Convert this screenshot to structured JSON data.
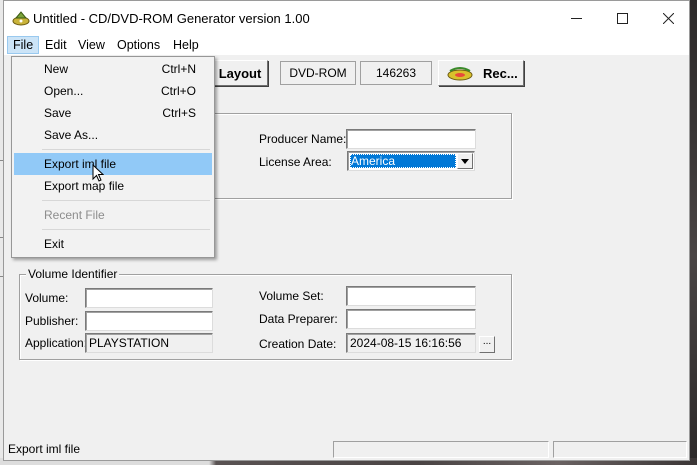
{
  "window": {
    "title": "Untitled - CD/DVD-ROM Generator version 1.00",
    "controls": {
      "minimize": "minimize-icon",
      "maximize": "maximize-icon",
      "close": "close-icon"
    }
  },
  "menubar": {
    "items": [
      "File",
      "Edit",
      "View",
      "Options",
      "Help"
    ],
    "active": "File"
  },
  "file_menu": {
    "items": [
      {
        "label": "New",
        "shortcut": "Ctrl+N"
      },
      {
        "label": "Open...",
        "shortcut": "Ctrl+O"
      },
      {
        "label": "Save",
        "shortcut": "Ctrl+S"
      },
      {
        "label": "Save As...",
        "shortcut": ""
      },
      {
        "label": "Export iml file",
        "shortcut": ""
      },
      {
        "label": "Export map file",
        "shortcut": ""
      },
      {
        "label": "Recent File",
        "shortcut": ""
      },
      {
        "label": "Exit",
        "shortcut": ""
      }
    ],
    "highlighted": "Export iml file",
    "disabled": [
      "Recent File"
    ]
  },
  "toolbar": {
    "layout_label": "Layout",
    "media_type": "DVD-ROM",
    "sector_count": "146263",
    "record_label": "Rec..."
  },
  "disc_info": {
    "producer_name_label": "Producer Name:",
    "producer_name": "",
    "license_area_label": "License Area:",
    "license_area": "America"
  },
  "volume_identifier": {
    "legend": "Volume Identifier",
    "volume_label": "Volume:",
    "volume": "",
    "publisher_label": "Publisher:",
    "publisher": "",
    "application_label": "Application:",
    "application": "PLAYSTATION",
    "volume_set_label": "Volume Set:",
    "volume_set": "",
    "data_preparer_label": "Data Preparer:",
    "data_preparer": "",
    "creation_date_label": "Creation Date:",
    "creation_date": "2024-08-15 16:16:56",
    "date_button": "..."
  },
  "statusbar": {
    "text": "Export iml file"
  },
  "colors": {
    "menu_highlight": "#91c9f7",
    "selection": "#0078d7",
    "window_bg": "#f0f0f0"
  }
}
